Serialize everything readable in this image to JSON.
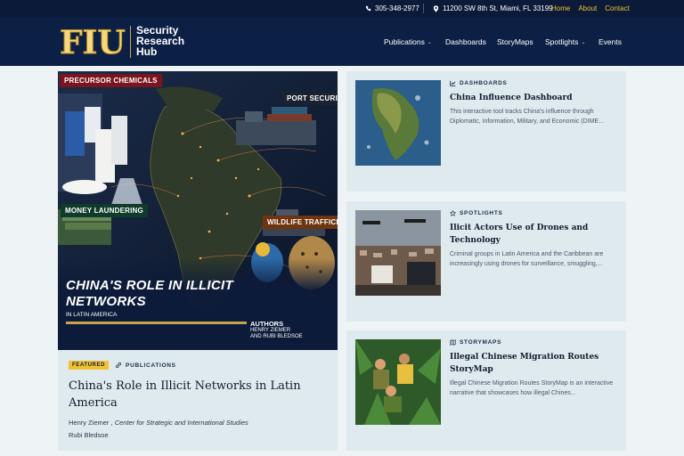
{
  "topbar": {
    "phone": "305-348-2977",
    "address": "11200 SW 8th St, Miami, FL 33199",
    "links": [
      "Home",
      "About",
      "Contact"
    ],
    "phone_icon": "phone-icon",
    "pin_icon": "map-pin-icon"
  },
  "brand": {
    "logo_letters": "FIU",
    "line1": "Security",
    "line2": "Research",
    "line3": "Hub"
  },
  "nav": {
    "items": [
      "Publications",
      "Dashboards",
      "StoryMaps",
      "Spotlights",
      "Events"
    ]
  },
  "featured": {
    "image": {
      "tags": [
        "PRECURSOR CHEMICALS",
        "PORT SECURITY",
        "MONEY LAUNDERING",
        "WILDLIFE TRAFFICKING"
      ],
      "title_line1": "CHINA'S ROLE IN ILLICIT",
      "title_line2": "NETWORKS",
      "subtitle": "IN LATIN AMERICA",
      "authors_label": "AUTHORS",
      "author1": "HENRY ZIEMER",
      "author2": "AND RUBI BLEDSOE"
    },
    "badge": "FEATURED",
    "category": "PUBLICATIONS",
    "title": "China's Role in Illicit Networks in Latin America",
    "author1_name": "Henry Ziemer",
    "author1_sep": " , ",
    "author1_org": "Center for Strategic and International Studies",
    "author2_name": "Rubi Bledsoe"
  },
  "cards": [
    {
      "category": "DASHBOARDS",
      "icon": "chart-icon",
      "title": "China Influence Dashboard",
      "description": "This interactive tool tracks China's influence through Diplomatic, Information, Military, and Economic (DIME..."
    },
    {
      "category": "SPOTLIGHTS",
      "icon": "star-icon",
      "title": "Ilicit Actors Use of Drones and Technology",
      "description": "Criminal groups in Latin America and the Caribbean are increasingly using drones for surveillance, smuggling,..."
    },
    {
      "category": "STORYMAPS",
      "icon": "map-icon",
      "title": "Illegal Chinese Migration Routes StoryMap",
      "description": "Illegal Chinese Migration Routes StoryMap is an interactive narrative that showcases how illegal Chines..."
    }
  ],
  "colors": {
    "navy": "#0c2046",
    "gold": "#f2c230",
    "card_bg": "#dfeaef"
  }
}
